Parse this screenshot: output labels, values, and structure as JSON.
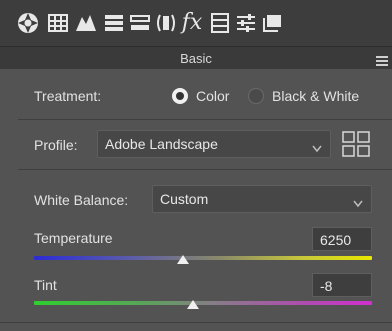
{
  "toolbar": {
    "icons": [
      "aperture-icon",
      "histogram-grid-icon",
      "tone-curve-icon",
      "hsl-panel-icon",
      "split-toning-icon",
      "lens-corrections-icon",
      "effects-fx-icon",
      "camera-calibration-icon",
      "presets-sliders-icon",
      "snapshots-icon"
    ]
  },
  "panel": {
    "title": "Basic"
  },
  "treatment": {
    "label": "Treatment:",
    "options": [
      "Color",
      "Black & White"
    ],
    "selected": "Color"
  },
  "profile": {
    "label": "Profile:",
    "value": "Adobe Landscape"
  },
  "white_balance": {
    "label": "White Balance:",
    "value": "Custom"
  },
  "temperature": {
    "label": "Temperature",
    "value": "6250",
    "slider_fraction": 0.44
  },
  "tint": {
    "label": "Tint",
    "value": "-8",
    "slider_fraction": 0.47
  },
  "colors": {
    "panel_bg": "#535353",
    "toolbar_bg": "#3d3d3d",
    "text": "#e6e6e6"
  }
}
